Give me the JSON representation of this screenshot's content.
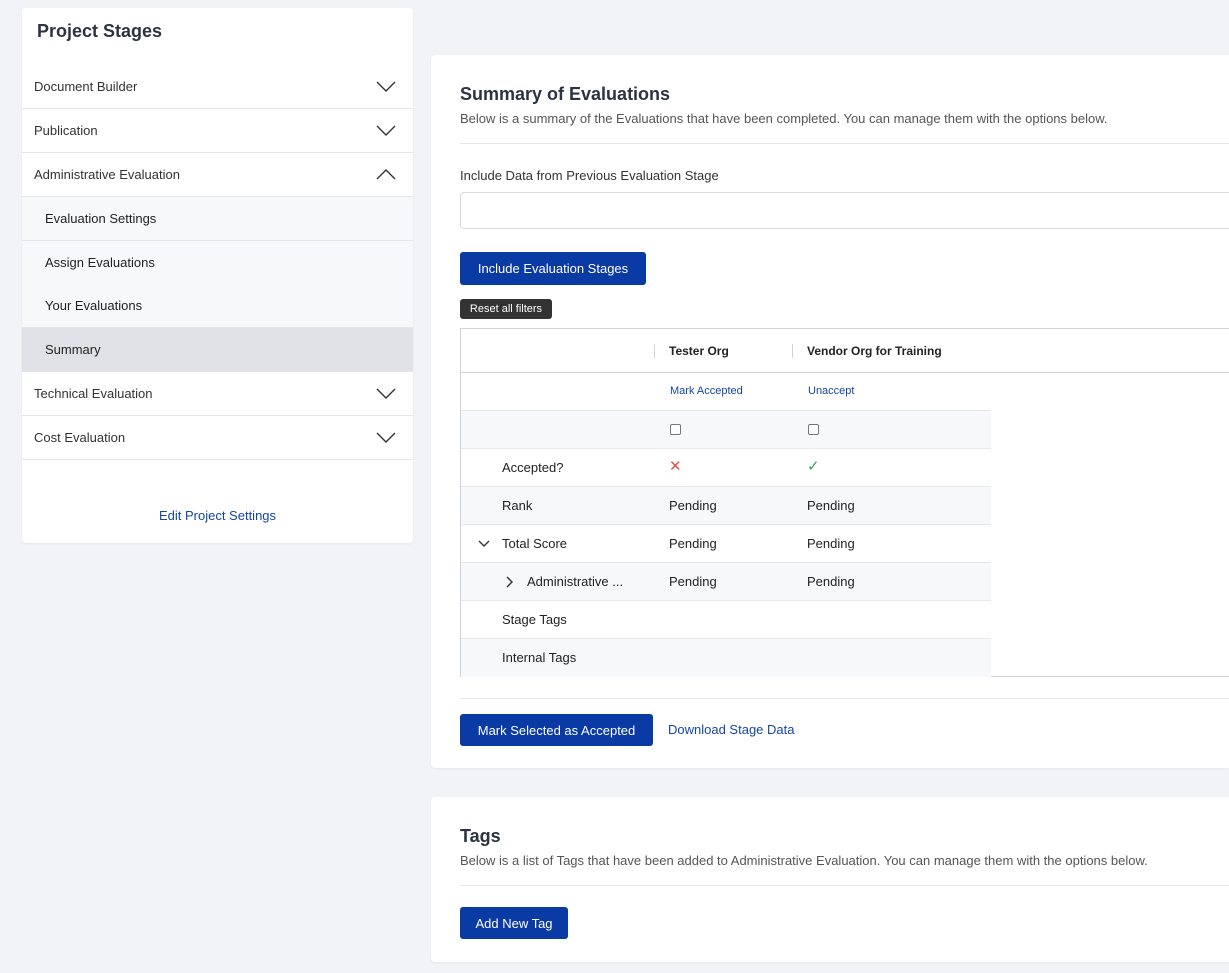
{
  "sidebar": {
    "title": "Project Stages",
    "stages": [
      {
        "label": "Document Builder",
        "expanded": false
      },
      {
        "label": "Publication",
        "expanded": false
      },
      {
        "label": "Administrative Evaluation",
        "expanded": true
      },
      {
        "label": "Technical Evaluation",
        "expanded": false
      },
      {
        "label": "Cost Evaluation",
        "expanded": false
      }
    ],
    "sub_items": [
      {
        "label": "Evaluation Settings",
        "active": false
      },
      {
        "label": "Assign Evaluations",
        "active": false
      },
      {
        "label": "Your Evaluations",
        "active": false
      },
      {
        "label": "Summary",
        "active": true
      }
    ],
    "edit_link": "Edit Project Settings"
  },
  "summary": {
    "title": "Summary of Evaluations",
    "description": "Below is a summary of the Evaluations that have been completed. You can manage them with the options below.",
    "include_label": "Include Data from Previous Evaluation Stage",
    "include_value": "",
    "include_button": "Include Evaluation Stages",
    "reset_button": "Reset all filters",
    "table": {
      "columns": [
        "Tester Org",
        "Vendor Org for Training"
      ],
      "actions": [
        "Mark Accepted",
        "Unaccept"
      ],
      "accepted_label": "Accepted?",
      "accepted": [
        false,
        true
      ],
      "rank_label": "Rank",
      "rank": [
        "Pending",
        "Pending"
      ],
      "total_label": "Total Score",
      "total": [
        "Pending",
        "Pending"
      ],
      "admin_label": "Administrative ...",
      "admin": [
        "Pending",
        "Pending"
      ],
      "stage_tags_label": "Stage Tags",
      "internal_tags_label": "Internal Tags"
    },
    "mark_button": "Mark Selected as Accepted",
    "download_link": "Download Stage Data"
  },
  "tags": {
    "title": "Tags",
    "description": "Below is a list of Tags that have been added to Administrative Evaluation. You can manage them with the options below.",
    "add_button": "Add New Tag"
  },
  "icons": {
    "chevron_down": "chevron-down-icon",
    "chevron_up": "chevron-up-icon",
    "cross": "cross-icon",
    "check": "check-icon"
  },
  "colors": {
    "primary": "#0a3aa3",
    "link": "#1546a3",
    "background": "#f2f3f6",
    "reject": "#d9534f",
    "accept": "#3aa35a"
  }
}
